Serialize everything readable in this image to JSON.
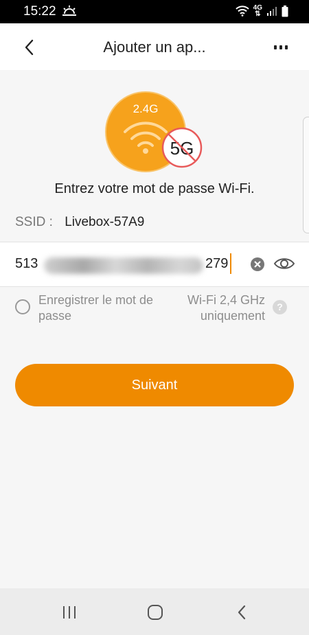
{
  "status": {
    "time": "15:22",
    "network": "4G"
  },
  "header": {
    "title": "Ajouter un ap..."
  },
  "illustration": {
    "band_ok": "2.4G",
    "band_no": "5G"
  },
  "prompt": "Entrez votre mot de passe Wi-Fi.",
  "ssid": {
    "label": "SSID :",
    "value": "Livebox-57A9"
  },
  "password": {
    "prefix": "513",
    "suffix": "279"
  },
  "options": {
    "save_password": "Enregistrer le mot de passe",
    "wifi_note": "Wi-Fi 2,4 GHz uniquement",
    "help": "?"
  },
  "next_button": "Suivant",
  "colors": {
    "accent": "#ef8a00",
    "no5g": "#e85a5a"
  }
}
